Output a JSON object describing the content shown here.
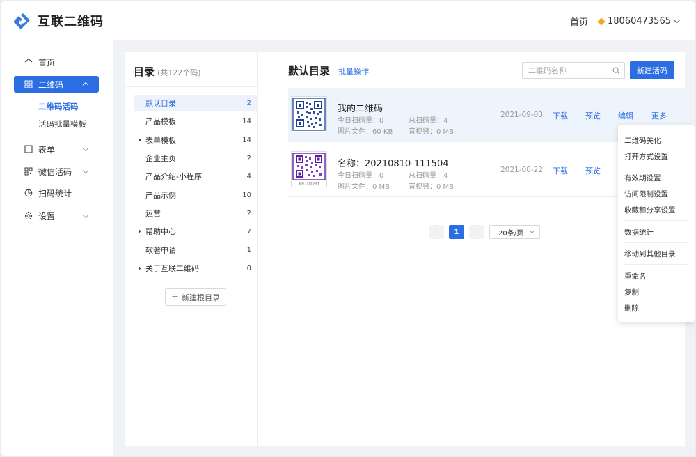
{
  "header": {
    "brand": "互联二维码",
    "home_label": "首页",
    "account": "18060473565"
  },
  "sidebar": {
    "items": [
      {
        "label": "首页",
        "icon": "home-icon"
      },
      {
        "label": "二维码",
        "icon": "grid-icon"
      },
      {
        "label": "表单",
        "icon": "form-icon"
      },
      {
        "label": "微信活码",
        "icon": "qr-icon"
      },
      {
        "label": "扫码统计",
        "icon": "clock-icon"
      },
      {
        "label": "设置",
        "icon": "gear-icon"
      }
    ],
    "sub_items": [
      {
        "label": "二维码活码"
      },
      {
        "label": "活码批量模板"
      }
    ]
  },
  "directory": {
    "title": "目录",
    "count": "(共122个码)",
    "items": [
      {
        "label": "默认目录",
        "count": "2"
      },
      {
        "label": "产品模板",
        "count": "14"
      },
      {
        "label": "表单模板",
        "count": "14"
      },
      {
        "label": "企业主页",
        "count": "2"
      },
      {
        "label": "产品介绍-小程序",
        "count": "4"
      },
      {
        "label": "产品示例",
        "count": "10"
      },
      {
        "label": "运营",
        "count": "2"
      },
      {
        "label": "帮助中心",
        "count": "7"
      },
      {
        "label": "软著申请",
        "count": "1"
      },
      {
        "label": "关于互联二维码",
        "count": "0"
      }
    ],
    "new_root_label": "新建根目录"
  },
  "content": {
    "title": "默认目录",
    "batch_label": "批量操作",
    "search_placeholder": "二维码名称",
    "new_button": "新建活码",
    "rows": [
      {
        "name": "我的二维码",
        "today_scan": "今日扫码量：0",
        "total_scan": "总扫码量：4",
        "image_file": "图片文件：60 KB",
        "av_file": "音视频：0 MB",
        "date": "2021-09-03",
        "download": "下载",
        "preview": "预览",
        "edit": "编辑",
        "more": "更多"
      },
      {
        "name": "名称：20210810-111504",
        "today_scan": "今日扫码量：0",
        "total_scan": "总扫码量：4",
        "image_file": "图片文件：0 MB",
        "av_file": "音视频：0 MB",
        "date": "2021-08-22",
        "download": "下载",
        "preview": "预览",
        "thumb_caption": "名称：2021081"
      }
    ],
    "pager": {
      "current": "1",
      "page_size": "20条/页"
    }
  },
  "menu": {
    "items": [
      "二维码美化",
      "打开方式设置",
      "有效期设置",
      "访问限制设置",
      "收藏和分享设置",
      "数据统计",
      "移动到其他目录",
      "重命名",
      "复制",
      "删除"
    ]
  },
  "colors": {
    "accent": "#2b6ee3",
    "logo_blue": "#3a7bd5"
  }
}
